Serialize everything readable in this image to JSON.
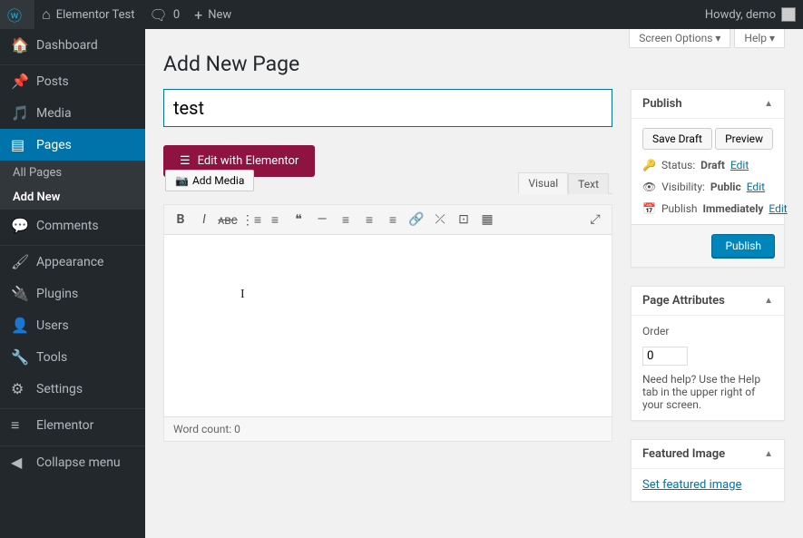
{
  "adminbar": {
    "site_name": "Elementor Test",
    "comment_count": "0",
    "new_label": "New",
    "howdy": "Howdy, demo"
  },
  "sidebar": {
    "dashboard": "Dashboard",
    "posts": "Posts",
    "media": "Media",
    "pages": "Pages",
    "all_pages": "All Pages",
    "add_new": "Add New",
    "comments": "Comments",
    "appearance": "Appearance",
    "plugins": "Plugins",
    "users": "Users",
    "tools": "Tools",
    "settings": "Settings",
    "elementor": "Elementor",
    "collapse": "Collapse menu"
  },
  "screen_meta": {
    "screen_options": "Screen Options ▾",
    "help": "Help ▾"
  },
  "page": {
    "heading": "Add New Page",
    "title_value": "test",
    "elementor_btn": "Edit with Elementor",
    "add_media": "Add Media"
  },
  "tabs": {
    "visual": "Visual",
    "text": "Text"
  },
  "footer": {
    "word_count": "Word count: 0"
  },
  "publish": {
    "title": "Publish",
    "save_draft": "Save Draft",
    "preview": "Preview",
    "status_label": "Status:",
    "status_value": "Draft",
    "visibility_label": "Visibility:",
    "visibility_value": "Public",
    "publish_label": "Publish",
    "publish_value": "Immediately",
    "edit": "Edit",
    "publish_btn": "Publish"
  },
  "page_attrs": {
    "title": "Page Attributes",
    "order_label": "Order",
    "order_value": "0",
    "help_text": "Need help? Use the Help tab in the upper right of your screen."
  },
  "featured": {
    "title": "Featured Image",
    "set": "Set featured image"
  }
}
